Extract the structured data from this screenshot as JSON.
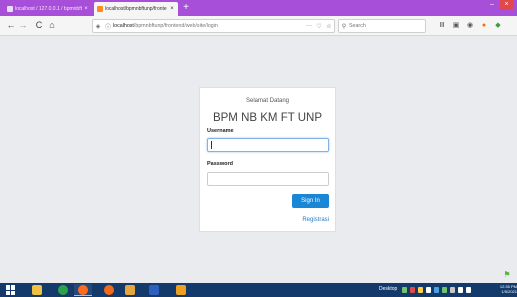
{
  "browser": {
    "tabs": [
      {
        "title": "localhost / 127.0.0.1 / bpmnbft"
      },
      {
        "title": "localhost/bpmnbftunp/fronte"
      }
    ],
    "new_tab_symbol": "+",
    "window_controls": {
      "minimize": "–",
      "close": "×"
    },
    "nav": {
      "back": "←",
      "forward": "→",
      "reload": "C",
      "home": "⌂"
    },
    "url": {
      "host": "localhost",
      "path": "/bpmnbftunp/frontend/web/site/login"
    },
    "url_actions": {
      "more": "···",
      "pocket": "♡",
      "bookmark": "☆"
    },
    "search": {
      "placeholder": "Search"
    },
    "toolbar_icons": [
      "library-icon",
      "sidebar-icon",
      "account-icon",
      "extension-icon",
      "extension-icon"
    ]
  },
  "login": {
    "welcome": "Selamat Datang",
    "title": "BPM NB KM FT UNP",
    "username_label": "Username",
    "password_label": "Password",
    "signin_label": "Sign In",
    "register_label": "Registrasi"
  },
  "taskbar": {
    "desktop_label": "Desktop",
    "clock": "12:35 PM 1/5/2021"
  },
  "colors": {
    "tabbar": "#a74fd8",
    "accent": "#1a86d6",
    "link": "#2a7cc4",
    "taskbar": "#143a6b",
    "page_bg": "#e9ebee"
  }
}
